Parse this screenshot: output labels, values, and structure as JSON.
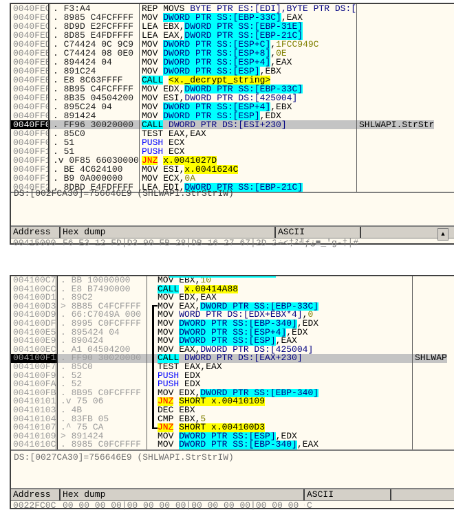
{
  "panels": [
    {
      "rows": [
        {
          "addr": "0040FEC4",
          "mark": ".",
          "hex": "F3:A4",
          "dis": [
            [
              "REP MOVS ",
              "n"
            ],
            [
              "BYTE PTR ES:[EDI],BYTE PTR DS:[ESI]",
              "d"
            ]
          ],
          "comment": ""
        },
        {
          "addr": "0040FEC6",
          "mark": ".",
          "hex": "8985 C4FCFFFF",
          "dis": [
            [
              "MOV ",
              "n"
            ],
            [
              "DWORD PTR SS:[EBP-33C]",
              "m"
            ],
            [
              ",EAX",
              "n"
            ]
          ],
          "comment": ""
        },
        {
          "addr": "0040FECC",
          "mark": ".",
          "hex": "8D9D E2FCFFFF",
          "dis": [
            [
              "LEA EBX,",
              "n"
            ],
            [
              "DWORD PTR SS:[EBP-31E]",
              "m"
            ]
          ],
          "comment": ""
        },
        {
          "addr": "0040FED2",
          "mark": ".",
          "hex": "8D85 E4FDFFFF",
          "dis": [
            [
              "LEA EAX,",
              "n"
            ],
            [
              "DWORD PTR SS:[EBP-21C]",
              "m"
            ]
          ],
          "comment": ""
        },
        {
          "addr": "0040FED8",
          "mark": ".",
          "hex": "C74424 0C 9C9",
          "dis": [
            [
              "MOV ",
              "n"
            ],
            [
              "DWORD PTR SS:[ESP+C]",
              "m"
            ],
            [
              ",",
              "n"
            ],
            [
              "1FCC949C",
              "k"
            ]
          ],
          "comment": ""
        },
        {
          "addr": "0040FEE0",
          "mark": ".",
          "hex": "C74424 08 0E0",
          "dis": [
            [
              "MOV ",
              "n"
            ],
            [
              "DWORD PTR SS:[ESP+8]",
              "m"
            ],
            [
              ",",
              "n"
            ],
            [
              "0E",
              "k"
            ]
          ],
          "comment": ""
        },
        {
          "addr": "0040FEE8",
          "mark": ".",
          "hex": "894424 04",
          "dis": [
            [
              "MOV ",
              "n"
            ],
            [
              "DWORD PTR SS:[ESP+4]",
              "m"
            ],
            [
              ",EAX",
              "n"
            ]
          ],
          "comment": ""
        },
        {
          "addr": "0040FEEC",
          "mark": ".",
          "hex": "891C24",
          "dis": [
            [
              "MOV ",
              "n"
            ],
            [
              "DWORD PTR SS:[ESP]",
              "m"
            ],
            [
              ",EBX",
              "n"
            ]
          ],
          "comment": ""
        },
        {
          "addr": "0040FEEF",
          "mark": ".",
          "hex": "E8 8C63FFFF",
          "dis": [
            [
              "CALL",
              "c"
            ],
            [
              " ",
              "n"
            ],
            [
              "<x._decrypt_string>",
              "y"
            ]
          ],
          "comment": ""
        },
        {
          "addr": "0040FEF4",
          "mark": ".",
          "hex": "8B95 C4FCFFFF",
          "dis": [
            [
              "MOV EDX,",
              "n"
            ],
            [
              "DWORD PTR SS:[EBP-33C]",
              "m"
            ]
          ],
          "comment": ""
        },
        {
          "addr": "0040FEFA",
          "mark": ".",
          "hex": "8B35 04504200",
          "dis": [
            [
              "MOV ESI,",
              "n"
            ],
            [
              "DWORD PTR DS:[425004]",
              "d"
            ]
          ],
          "comment": ""
        },
        {
          "addr": "0040FF00",
          "mark": ".",
          "hex": "895C24 04",
          "dis": [
            [
              "MOV ",
              "n"
            ],
            [
              "DWORD PTR SS:[ESP+4]",
              "m"
            ],
            [
              ",EBX",
              "n"
            ]
          ],
          "comment": ""
        },
        {
          "addr": "0040FF04",
          "mark": ".",
          "hex": "891424",
          "dis": [
            [
              "MOV ",
              "n"
            ],
            [
              "DWORD PTR SS:[ESP]",
              "m"
            ],
            [
              ",EDX",
              "n"
            ]
          ],
          "comment": ""
        },
        {
          "addr": "0040FF07",
          "mark": ".",
          "hex": "FF96 30020000",
          "dis": [
            [
              "CALL",
              "c"
            ],
            [
              " DWORD PTR DS:[ESI+230]",
              "d"
            ]
          ],
          "comment": "SHLWAPI.StrStr",
          "selected": true
        },
        {
          "addr": "0040FF0D",
          "mark": ".",
          "hex": "85C0",
          "dis": [
            [
              "TEST EAX,EAX",
              "n"
            ]
          ],
          "comment": ""
        },
        {
          "addr": "0040FF0F",
          "mark": ".",
          "hex": "51",
          "dis": [
            [
              "PUSH",
              "p"
            ],
            [
              " ECX",
              "n"
            ]
          ],
          "comment": ""
        },
        {
          "addr": "0040FF10",
          "mark": ".",
          "hex": "51",
          "dis": [
            [
              "PUSH",
              "p"
            ],
            [
              " ECX",
              "n"
            ]
          ],
          "comment": ""
        },
        {
          "addr": "0040FF11",
          "mark": ".v",
          "hex": "0F85 66030000",
          "dis": [
            [
              "JNZ",
              "j"
            ],
            [
              " ",
              "n"
            ],
            [
              "x.0041027D",
              "y"
            ]
          ],
          "comment": ""
        },
        {
          "addr": "0040FF17",
          "mark": ".",
          "hex": "BE 4C624100",
          "dis": [
            [
              "MOV ESI,",
              "n"
            ],
            [
              "x.0041624C",
              "y"
            ]
          ],
          "comment": ""
        },
        {
          "addr": "0040FF1C",
          "mark": ".",
          "hex": "B9 0A000000",
          "dis": [
            [
              "MOV ECX,",
              "n"
            ],
            [
              "0A",
              "k"
            ]
          ],
          "comment": ""
        },
        {
          "addr": "0040FF21",
          "mark": ".",
          "hex": "8DBD E4FDFFFF",
          "dis": [
            [
              "LEA EDI,",
              "n"
            ],
            [
              "DWORD PTR SS:[EBP-21C]",
              "m"
            ]
          ],
          "comment": ""
        }
      ],
      "info": "DS:[002FCA30]=756646E9 (SHLWAPI.StrStrIW)",
      "dump": {
        "headers": [
          "Address",
          "Hex dump",
          "ASCII"
        ],
        "row": {
          "addr": "00415000",
          "hex": "F6 E3 12 FD|D3 90 FB 28|DB 16 27 67|2D 21 B3 23",
          "ascii": "÷<‡²╝ƒ¿■_'g-†│#"
        }
      }
    },
    {
      "rows": [
        {
          "addr": "004100C7",
          "mark": ".",
          "hex": "BB 10000000",
          "dis": [
            [
              "MOV EBX,",
              "n"
            ],
            [
              "10",
              "k"
            ]
          ],
          "comment": ""
        },
        {
          "addr": "004100CC",
          "mark": ".",
          "hex": "E8 B7490000",
          "dis": [
            [
              "CALL",
              "c"
            ],
            [
              " ",
              "n"
            ],
            [
              "x.00414A88",
              "y"
            ]
          ],
          "comment": ""
        },
        {
          "addr": "004100D1",
          "mark": ".",
          "hex": "89C2",
          "dis": [
            [
              "MOV EDX,EAX",
              "n"
            ]
          ],
          "comment": ""
        },
        {
          "addr": "004100D3",
          "mark": ">",
          "hex": "8B85 C4FCFFFF",
          "dis": [
            [
              "MOV EAX,",
              "n"
            ],
            [
              "DWORD PTR SS:[EBP-33C]",
              "m"
            ]
          ],
          "comment": "",
          "jump": "start"
        },
        {
          "addr": "004100D9",
          "mark": ".",
          "hex": "66:C7049A 000",
          "dis": [
            [
              "MOV ",
              "n"
            ],
            [
              "WORD PTR DS:[EDX+EBX*4]",
              "d"
            ],
            [
              ",",
              "n"
            ],
            [
              "0",
              "k"
            ]
          ],
          "comment": "",
          "jump": "mid"
        },
        {
          "addr": "004100DF",
          "mark": ".",
          "hex": "8995 C0FCFFFF",
          "dis": [
            [
              "MOV ",
              "n"
            ],
            [
              "DWORD PTR SS:[EBP-340]",
              "m"
            ],
            [
              ",EDX",
              "n"
            ]
          ],
          "comment": "",
          "jump": "mid"
        },
        {
          "addr": "004100E5",
          "mark": ".",
          "hex": "895424 04",
          "dis": [
            [
              "MOV ",
              "n"
            ],
            [
              "DWORD PTR SS:[ESP+4]",
              "m"
            ],
            [
              ",EDX",
              "n"
            ]
          ],
          "comment": "",
          "jump": "mid"
        },
        {
          "addr": "004100E9",
          "mark": ".",
          "hex": "890424",
          "dis": [
            [
              "MOV ",
              "n"
            ],
            [
              "DWORD PTR SS:[ESP]",
              "m"
            ],
            [
              ",EAX",
              "n"
            ]
          ],
          "comment": "",
          "jump": "mid"
        },
        {
          "addr": "004100EC",
          "mark": ".",
          "hex": "A1 04504200",
          "dis": [
            [
              "MOV EAX,",
              "n"
            ],
            [
              "DWORD PTR DS:[425004]",
              "d"
            ]
          ],
          "comment": "",
          "jump": "mid"
        },
        {
          "addr": "004100F1",
          "mark": ".",
          "hex": "FF90 30020000",
          "dis": [
            [
              "CALL",
              "c"
            ],
            [
              " DWORD PTR DS:[EAX+230]",
              "d"
            ]
          ],
          "comment": "SHLWAP",
          "selected": true,
          "jump": "mid"
        },
        {
          "addr": "004100F7",
          "mark": ".",
          "hex": "85C0",
          "dis": [
            [
              "TEST EAX,EAX",
              "n"
            ]
          ],
          "comment": "",
          "jump": "mid"
        },
        {
          "addr": "004100F9",
          "mark": ".",
          "hex": "52",
          "dis": [
            [
              "PUSH",
              "p"
            ],
            [
              " EDX",
              "n"
            ]
          ],
          "comment": "",
          "jump": "mid"
        },
        {
          "addr": "004100FA",
          "mark": ".",
          "hex": "52",
          "dis": [
            [
              "PUSH",
              "p"
            ],
            [
              " EDX",
              "n"
            ]
          ],
          "comment": "",
          "jump": "mid"
        },
        {
          "addr": "004100FB",
          "mark": ".",
          "hex": "8B95 C0FCFFFF",
          "dis": [
            [
              "MOV EDX,",
              "n"
            ],
            [
              "DWORD PTR SS:[EBP-340]",
              "m"
            ]
          ],
          "comment": "",
          "jump": "mid"
        },
        {
          "addr": "00410101",
          "mark": ".v",
          "hex": "75 06",
          "dis": [
            [
              "JNZ",
              "j"
            ],
            [
              " ",
              "n"
            ],
            [
              "SHORT x.00410109",
              "y"
            ]
          ],
          "comment": "",
          "jump": "mid"
        },
        {
          "addr": "00410103",
          "mark": ".",
          "hex": "4B",
          "dis": [
            [
              "DEC EBX",
              "n"
            ]
          ],
          "comment": "",
          "jump": "mid"
        },
        {
          "addr": "00410104",
          "mark": ".",
          "hex": "83FB 05",
          "dis": [
            [
              "CMP EBX,",
              "n"
            ],
            [
              "5",
              "k"
            ]
          ],
          "comment": "",
          "jump": "mid"
        },
        {
          "addr": "00410107",
          "mark": ".^",
          "hex": "75 CA",
          "dis": [
            [
              "JNZ",
              "j"
            ],
            [
              " ",
              "n"
            ],
            [
              "SHORT x.004100D3",
              "y"
            ]
          ],
          "comment": "",
          "jump": "end"
        },
        {
          "addr": "00410109",
          "mark": ">",
          "hex": "891424",
          "dis": [
            [
              "MOV ",
              "n"
            ],
            [
              "DWORD PTR SS:[ESP]",
              "m"
            ],
            [
              ",EDX",
              "n"
            ]
          ],
          "comment": ""
        },
        {
          "addr": "0041010C",
          "mark": ".",
          "hex": "8985 C0FCFFFF",
          "dis": [
            [
              "MOV ",
              "n"
            ],
            [
              "DWORD PTR SS:[EBP-340]",
              "m"
            ],
            [
              ",EAX",
              "n"
            ]
          ],
          "comment": ""
        }
      ],
      "info": "DS:[0027CA30]=756646E9 (SHLWAPI.StrStrIW)",
      "dump": {
        "headers": [
          "Address",
          "Hex dump",
          "ASCII"
        ],
        "row": {
          "addr": "0022FC0C",
          "hex": "00 00 00 00|00 00 00 00|00 00 00 00|00 00 00 00",
          "ascii": "C"
        }
      }
    }
  ],
  "colors": {
    "background": "#fffbf0",
    "memory_highlight": "#00ffff",
    "jump_highlight": "#ffff00",
    "jump_text": "#ff0000",
    "constant": "#808000",
    "push": "#0000ff"
  },
  "icons": {
    "scroll_up": "triangle-up-icon"
  }
}
